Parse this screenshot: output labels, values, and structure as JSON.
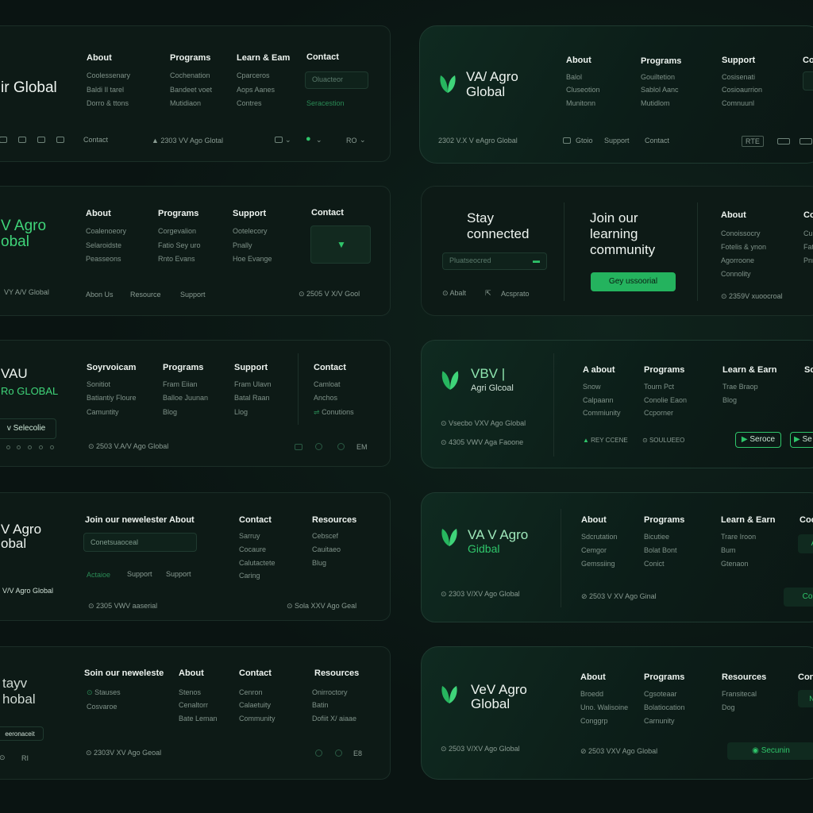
{
  "colors": {
    "accent": "#2fc56a",
    "bg": "#0a1412",
    "card": "#0d1a16"
  },
  "c1": {
    "brand": "ir Global",
    "cols": [
      {
        "h": "About",
        "items": [
          "Coolessenary",
          "Baldi Il tarel",
          "Dorro & ttons"
        ]
      },
      {
        "h": "Programs",
        "items": [
          "Cochenation",
          "Bandeet voet",
          "Mutidiaon"
        ]
      },
      {
        "h": "Learn & Eam",
        "items": [
          "Cparceros",
          "Aops Aanes",
          "Contres"
        ]
      },
      {
        "h": "Contact",
        "input": "Oluacteor",
        "link": "Seracestion"
      }
    ],
    "foot_contact": "Contact",
    "copyright": "2303 VV Ago Glotal",
    "lang": "RO"
  },
  "c2": {
    "brand1": "VA/ Agro",
    "brand2": "Global",
    "cols": [
      {
        "h": "About",
        "items": [
          "Balol",
          "Cluseotion",
          "Munitonn"
        ]
      },
      {
        "h": "Programs",
        "items": [
          "Gouiltetion",
          "Sablol Aanc",
          "Mutidlom"
        ]
      },
      {
        "h": "Support",
        "items": [
          "Cosisenati",
          "Cosioaurrion",
          "Comnuunl"
        ]
      },
      {
        "h": "Co",
        "items": []
      }
    ],
    "copyright": "2302 V.X V eAgro Global",
    "links": [
      "Gtoio",
      "Support",
      "Contact"
    ],
    "badge": "RTE"
  },
  "c3": {
    "brand1": "V Agro",
    "brand2": "obal",
    "cols": [
      {
        "h": "About",
        "items": [
          "Coalenoeory",
          "Selaroidste",
          "Peasseons"
        ]
      },
      {
        "h": "Programs",
        "items": [
          "Corgevalion",
          "Fatio Sey uro",
          "Rnto Evans"
        ]
      },
      {
        "h": "Support",
        "items": [
          "Ootelecory",
          "Pnally",
          "Hoe Evange"
        ]
      },
      {
        "h": "Contact",
        "items": []
      }
    ],
    "sub": "VY A/V Global",
    "links": [
      "Abon Us",
      "Resource",
      "Support"
    ],
    "copyright": "2505 V X/V Gool"
  },
  "c4": {
    "stay": [
      "Stay",
      "connected"
    ],
    "input": "Pluatseocred",
    "join1": "Join our",
    "join2": [
      "learning",
      "community"
    ],
    "button": "Gey ussoorial",
    "foot": [
      "Abalt",
      "Acsprato"
    ],
    "cols": [
      {
        "h": "About",
        "items": [
          "Conoissocry",
          "Fotelis & ynon",
          "Agorroone",
          "Connolity"
        ]
      },
      {
        "h": "Co",
        "items": [
          "Cul",
          "Fat",
          "Pnr"
        ]
      }
    ],
    "copyright": "2359V xuoocroal"
  },
  "c5": {
    "brand1": "VAU",
    "brand2": "Ro GLOBAL",
    "cols": [
      {
        "h": "Soyrvoicam",
        "items": [
          "Sonitiot",
          "Batiantiy Floure",
          "Camuntity"
        ]
      },
      {
        "h": "Programs",
        "items": [
          "Fram Eiian",
          "Balloe Juunan",
          "Blog"
        ]
      },
      {
        "h": "Support",
        "items": [
          "Fram Ulavn",
          "Batal Raan",
          "Llog"
        ]
      },
      {
        "h": "Contact",
        "items": [
          "Camloat",
          "Anchos",
          "Conutions"
        ]
      }
    ],
    "button": "v Selecolie",
    "copyright": "2503 V.A/V Ago Global",
    "lang": "EM"
  },
  "c6": {
    "brand1": "VBV |",
    "brand2": "Agri Glcoal",
    "lines": [
      "Vsecbo VXV Ago Global",
      "4305 VWV Aga Faoone"
    ],
    "cols": [
      {
        "h": "A about",
        "items": [
          "Snow",
          "Calpaann",
          "Commiunity"
        ]
      },
      {
        "h": "Programs",
        "items": [
          "Tourn Pct",
          "Conolie Eaon",
          "Ccporner"
        ]
      },
      {
        "h": "Learn & Earn",
        "items": [
          "Trae Braop",
          "Blog"
        ]
      },
      {
        "h": "So",
        "items": []
      }
    ],
    "foot": [
      "REY CCENE",
      "SOULUEEO"
    ],
    "buttons": [
      "Seroce",
      "Se"
    ]
  },
  "c7": {
    "brand1": "V Agro",
    "brand2": "obal",
    "newsletter": "Join our newelester About",
    "input": "Conetsuaoceal",
    "cols": [
      {
        "h": "Contact",
        "items": [
          "Sarruy",
          "Cocaure",
          "Calutactete",
          "Caring"
        ]
      },
      {
        "h": "Resources",
        "items": [
          "Cebscef",
          "Cauitaeo",
          "Blug"
        ]
      }
    ],
    "links": [
      "Actaioe",
      "Support",
      "Support"
    ],
    "sub": "V/V Agro Global",
    "copyright": "2305 VWV aaserial",
    "copyright2": "Sola XXV Ago Geal"
  },
  "c8": {
    "brand1": "VA V Agro",
    "brand2": "Gidbal",
    "cols": [
      {
        "h": "About",
        "items": [
          "Sdcrutation",
          "Cemgor",
          "Gemssiing"
        ]
      },
      {
        "h": "Programs",
        "items": [
          "Bicutiee",
          "Bolat Bont",
          "Conict"
        ]
      },
      {
        "h": "Learn & Earn",
        "items": [
          "Trare Iroon",
          "Bum",
          "Gtenaon"
        ]
      },
      {
        "h": "Coo",
        "items": []
      }
    ],
    "copyright": "2303 V/XV Ago Global",
    "copyright2": "2503 V XV Ago Ginal",
    "btn": "A",
    "btn2": "Co"
  },
  "c9": {
    "brand1": "tayv",
    "brand2": "hobal",
    "newsletter": "Soin our neweleste",
    "cols": [
      {
        "h": "About",
        "items": [
          "Stenos",
          "Cenaltorr",
          "Bate Leman"
        ]
      },
      {
        "h": "Contact",
        "items": [
          "Cenron",
          "Calaetuity",
          "Community"
        ]
      },
      {
        "h": "Resources",
        "items": [
          "Onirroctory",
          "Batin",
          "Dofiit X/ aiaae"
        ]
      }
    ],
    "left_items": [
      "Stauses",
      "Cosvaroe"
    ],
    "btn": "eeronaceit",
    "foot_right": "RI",
    "copyright": "2303V XV Ago Geoal",
    "lang": "E8"
  },
  "c10": {
    "brand1": "VeV Agro",
    "brand2": "Global",
    "cols": [
      {
        "h": "About",
        "items": [
          "Broedd",
          "Uno. Walisoine",
          "Conggrp"
        ]
      },
      {
        "h": "Programs",
        "items": [
          "Cgsoteaar",
          "Bolatiocation",
          "Carnunity"
        ]
      },
      {
        "h": "Resources",
        "items": [
          "Fransitecal",
          "Dog"
        ]
      },
      {
        "h": "Con",
        "items": []
      }
    ],
    "copyright": "2503 V/XV Ago Global",
    "copyright2": "2503 VXV Ago Global",
    "btn": "Secunin",
    "btn2": "Ne"
  }
}
